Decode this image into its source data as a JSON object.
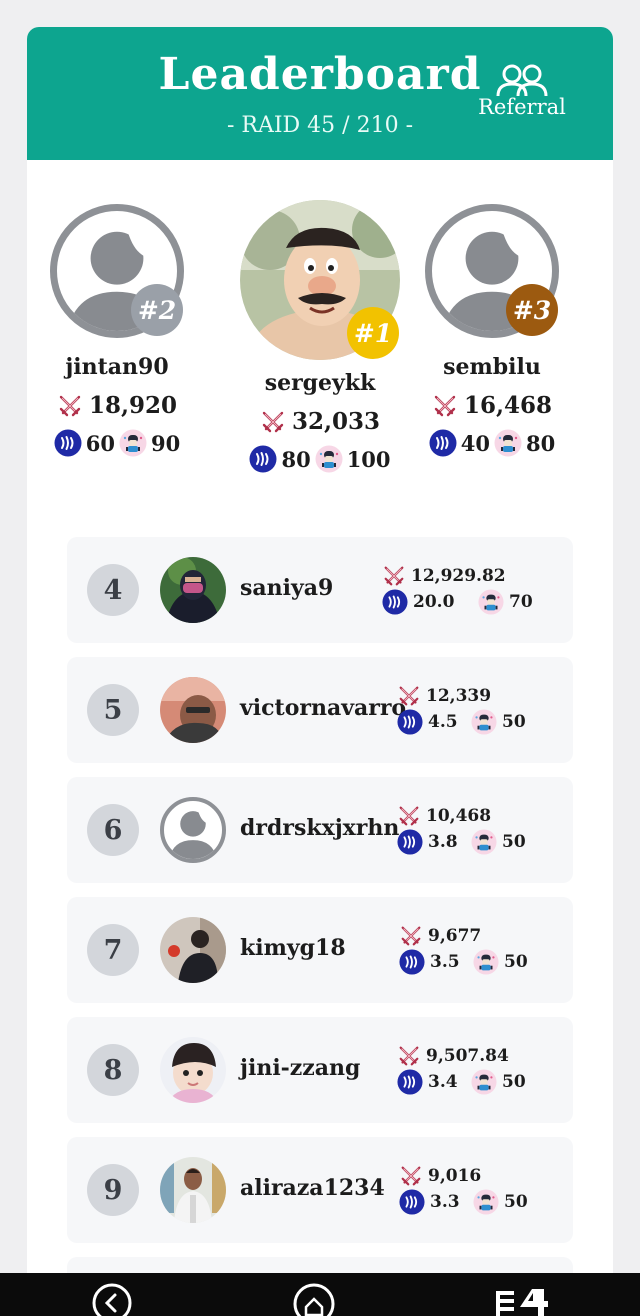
{
  "header": {
    "title": "Leaderboard",
    "subtitle": "- RAID 45 / 210 -",
    "referral_label": "Referral"
  },
  "colors": {
    "header_bg": "#0da58f",
    "gold": "#f2c200",
    "silver": "#9aa0a8",
    "bronze": "#9c5a10",
    "steem_blue": "#1f2aa6",
    "sword_red": "#b0304a"
  },
  "podium": [
    {
      "rank": "#2",
      "name": "jintan90",
      "score": "18,920",
      "steem": "60",
      "cards": "90"
    },
    {
      "rank": "#1",
      "name": "sergeykk",
      "score": "32,033",
      "steem": "80",
      "cards": "100"
    },
    {
      "rank": "#3",
      "name": "sembilu",
      "score": "16,468",
      "steem": "40",
      "cards": "80"
    }
  ],
  "rows": [
    {
      "rank": "4",
      "name": "saniya9",
      "score": "12,929.82",
      "steem": "20.0",
      "cards": "70"
    },
    {
      "rank": "5",
      "name": "victornavarro",
      "score": "12,339",
      "steem": "4.5",
      "cards": "50"
    },
    {
      "rank": "6",
      "name": "drdrskxjxrhn",
      "score": "10,468",
      "steem": "3.8",
      "cards": "50"
    },
    {
      "rank": "7",
      "name": "kimyg18",
      "score": "9,677",
      "steem": "3.5",
      "cards": "50"
    },
    {
      "rank": "8",
      "name": "jini-zzang",
      "score": "9,507.84",
      "steem": "3.4",
      "cards": "50"
    },
    {
      "rank": "9",
      "name": "aliraza1234",
      "score": "9,016",
      "steem": "3.3",
      "cards": "50"
    }
  ],
  "icons": {
    "referral": "users-icon",
    "score": "crossed-swords-icon",
    "steem": "steem-coin-icon",
    "cards": "monster-card-icon",
    "nav_back": "back-arrow-icon",
    "nav_home": "home-icon",
    "nav_menu": "app-switch-icon"
  }
}
